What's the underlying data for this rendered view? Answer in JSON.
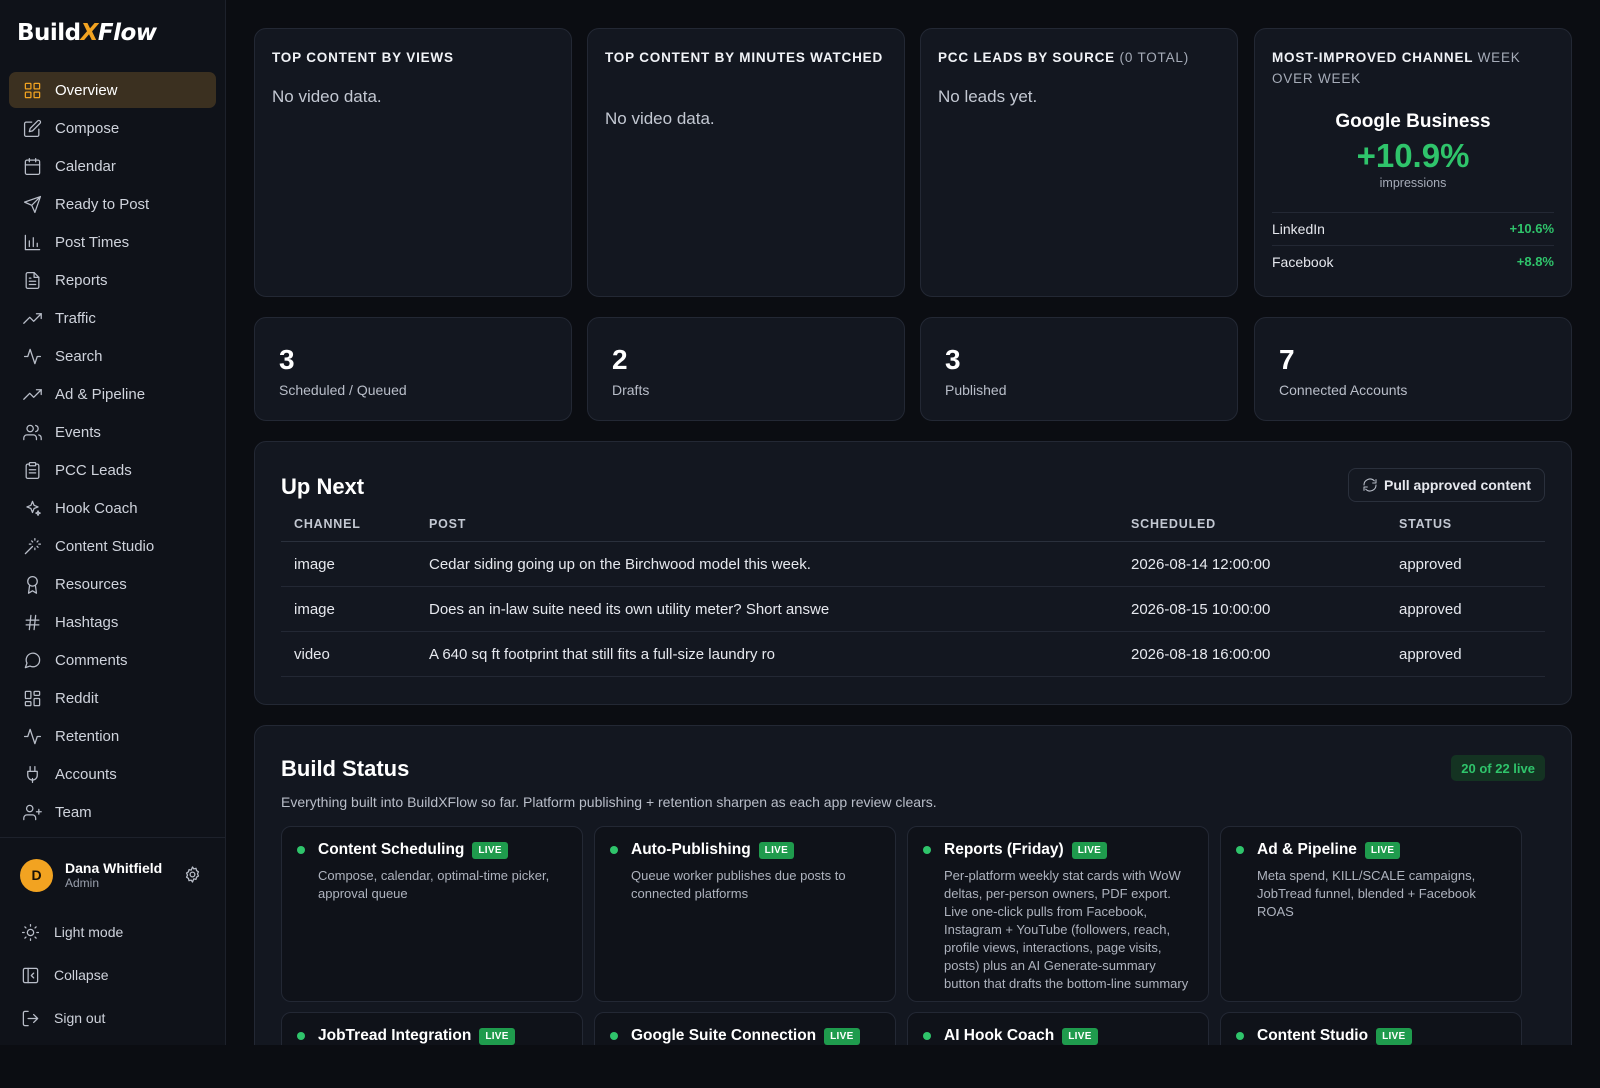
{
  "brand": {
    "part1": "Build",
    "part2": "X",
    "part3": "Flow"
  },
  "nav": [
    {
      "label": "Overview",
      "icon": "grid-icon",
      "active": true
    },
    {
      "label": "Compose",
      "icon": "edit-icon"
    },
    {
      "label": "Calendar",
      "icon": "calendar-icon"
    },
    {
      "label": "Ready to Post",
      "icon": "send-icon"
    },
    {
      "label": "Post Times",
      "icon": "bar-chart-icon"
    },
    {
      "label": "Reports",
      "icon": "file-text-icon"
    },
    {
      "label": "Traffic",
      "icon": "trending-up-icon"
    },
    {
      "label": "Search",
      "icon": "activity-icon"
    },
    {
      "label": "Ad & Pipeline",
      "icon": "trending-up-icon"
    },
    {
      "label": "Events",
      "icon": "users-icon"
    },
    {
      "label": "PCC Leads",
      "icon": "clipboard-icon"
    },
    {
      "label": "Hook Coach",
      "icon": "sparkles-icon"
    },
    {
      "label": "Content Studio",
      "icon": "wand-icon"
    },
    {
      "label": "Resources",
      "icon": "award-icon"
    },
    {
      "label": "Hashtags",
      "icon": "hash-icon"
    },
    {
      "label": "Comments",
      "icon": "message-circle-icon"
    },
    {
      "label": "Reddit",
      "icon": "layout-grid-icon"
    },
    {
      "label": "Retention",
      "icon": "activity-icon"
    },
    {
      "label": "Accounts",
      "icon": "plug-icon"
    },
    {
      "label": "Team",
      "icon": "user-plus-icon"
    }
  ],
  "user": {
    "initial": "D",
    "name": "Dana Whitfield",
    "role": "Admin"
  },
  "bottom": {
    "light_mode": "Light mode",
    "collapse": "Collapse",
    "sign_out": "Sign out"
  },
  "top_cards": {
    "views": {
      "title": "Top content by views",
      "empty": "No video data."
    },
    "minutes": {
      "title": "Top content by minutes watched",
      "empty": "No video data."
    },
    "leads": {
      "title": "PCC leads by source",
      "sub": "(0 total)",
      "empty": "No leads yet."
    },
    "improved": {
      "title": "Most-improved channel",
      "sub": "week over week",
      "channel": "Google Business",
      "pct": "+10.9%",
      "metric": "impressions",
      "rows": [
        {
          "name": "LinkedIn",
          "delta": "+10.6%"
        },
        {
          "name": "Facebook",
          "delta": "+8.8%"
        }
      ]
    }
  },
  "stats": [
    {
      "value": "3",
      "label": "Scheduled / Queued"
    },
    {
      "value": "2",
      "label": "Drafts"
    },
    {
      "value": "3",
      "label": "Published"
    },
    {
      "value": "7",
      "label": "Connected Accounts"
    }
  ],
  "up_next": {
    "title": "Up Next",
    "pull_button": "Pull approved content",
    "columns": [
      "CHANNEL",
      "POST",
      "SCHEDULED",
      "STATUS"
    ],
    "rows": [
      {
        "channel": "image",
        "post": "Cedar siding going up on the Birchwood model this week.",
        "scheduled": "2026-08-14 12:00:00",
        "status": "approved"
      },
      {
        "channel": "image",
        "post": "Does an in-law suite need its own utility meter? Short answe",
        "scheduled": "2026-08-15 10:00:00",
        "status": "approved"
      },
      {
        "channel": "video",
        "post": "A 640 sq ft footprint that still fits a full-size laundry ro",
        "scheduled": "2026-08-18 16:00:00",
        "status": "approved"
      }
    ]
  },
  "build_status": {
    "title": "Build Status",
    "live_count": "20 of 22 live",
    "description": "Everything built into BuildXFlow so far. Platform publishing + retention sharpen as each app review clears.",
    "features": [
      {
        "title": "Content Scheduling",
        "badge": "LIVE",
        "desc": "Compose, calendar, optimal-time picker, approval queue"
      },
      {
        "title": "Auto-Publishing",
        "badge": "LIVE",
        "desc": "Queue worker publishes due posts to connected platforms"
      },
      {
        "title": "Reports (Friday)",
        "badge": "LIVE",
        "desc": "Per-platform weekly stat cards with WoW deltas, per-person owners, PDF export. Live one-click pulls from Facebook, Instagram + YouTube (followers, reach, profile views, interactions, page visits, posts) plus an AI Generate-summary button that drafts the bottom-line summary"
      },
      {
        "title": "Ad & Pipeline",
        "badge": "LIVE",
        "desc": "Meta spend, KILL/SCALE campaigns, JobTread funnel, blended + Facebook ROAS"
      },
      {
        "title": "JobTread Integration",
        "badge": "LIVE",
        "desc": ""
      },
      {
        "title": "Google Suite Connection",
        "badge": "LIVE",
        "desc": ""
      },
      {
        "title": "AI Hook Coach",
        "badge": "LIVE",
        "desc": ""
      },
      {
        "title": "Content Studio",
        "badge": "LIVE",
        "desc": ""
      }
    ]
  },
  "colors": {
    "accent": "#f2a321",
    "positive": "#2fc46b",
    "background": "#0b0d12",
    "card": "#131720"
  }
}
